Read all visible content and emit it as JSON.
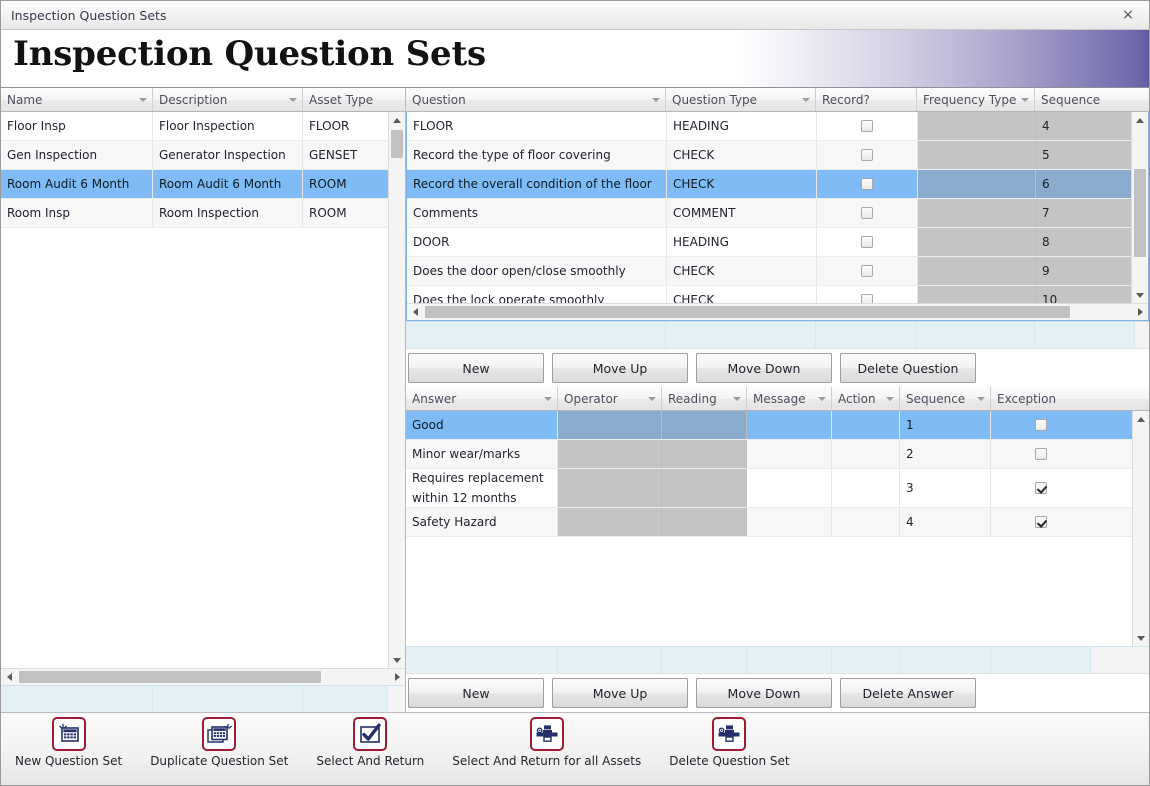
{
  "window": {
    "title": "Inspection Question Sets",
    "close_icon": "close-icon",
    "close_glyph": "×"
  },
  "header": {
    "title": "Inspection Question Sets"
  },
  "question_sets_grid": {
    "columns": [
      {
        "label": "Name",
        "sortable": true
      },
      {
        "label": "Description",
        "sortable": true
      },
      {
        "label": "Asset Type",
        "sortable": false
      }
    ],
    "rows": [
      {
        "name": "Floor Insp",
        "description": "Floor Inspection",
        "asset_type": "FLOOR",
        "selected": false
      },
      {
        "name": "Gen Inspection",
        "description": "Generator Inspection",
        "asset_type": "GENSET",
        "selected": false
      },
      {
        "name": "Room Audit 6 Month",
        "description": "Room Audit 6 Month",
        "asset_type": "ROOM",
        "selected": true
      },
      {
        "name": "Room Insp",
        "description": "Room Inspection",
        "asset_type": "ROOM",
        "selected": false
      }
    ]
  },
  "questions_grid": {
    "columns": [
      {
        "label": "Question",
        "sortable": true
      },
      {
        "label": "Question Type",
        "sortable": true
      },
      {
        "label": "Record?",
        "sortable": false
      },
      {
        "label": "Frequency Type",
        "sortable": true
      },
      {
        "label": "Sequence",
        "sortable": false
      }
    ],
    "rows": [
      {
        "question": "FLOOR",
        "type": "HEADING",
        "record": false,
        "frequency_type": "",
        "sequence": "4",
        "selected": false
      },
      {
        "question": "Record the type of floor covering",
        "type": "CHECK",
        "record": false,
        "frequency_type": "",
        "sequence": "5",
        "selected": false
      },
      {
        "question": "Record the overall condition of the floor",
        "type": "CHECK",
        "record": false,
        "frequency_type": "",
        "sequence": "6",
        "selected": true
      },
      {
        "question": "Comments",
        "type": "COMMENT",
        "record": false,
        "frequency_type": "",
        "sequence": "7",
        "selected": false
      },
      {
        "question": "DOOR",
        "type": "HEADING",
        "record": false,
        "frequency_type": "",
        "sequence": "8",
        "selected": false
      },
      {
        "question": "Does the door open/close smoothly",
        "type": "CHECK",
        "record": false,
        "frequency_type": "",
        "sequence": "9",
        "selected": false
      },
      {
        "question": "Does the lock operate smoothly",
        "type": "CHECK",
        "record": false,
        "frequency_type": "",
        "sequence": "10",
        "selected": false
      }
    ]
  },
  "question_buttons": {
    "new": "New",
    "move_up": "Move Up",
    "move_down": "Move Down",
    "delete": "Delete Question"
  },
  "answers_grid": {
    "columns": [
      {
        "label": "Answer",
        "sortable": true
      },
      {
        "label": "Operator",
        "sortable": true
      },
      {
        "label": "Reading",
        "sortable": true
      },
      {
        "label": "Message",
        "sortable": true
      },
      {
        "label": "Action",
        "sortable": true
      },
      {
        "label": "Sequence",
        "sortable": true
      },
      {
        "label": "Exception",
        "sortable": false
      }
    ],
    "rows": [
      {
        "answer": "Good",
        "operator": "",
        "reading": "",
        "message": "",
        "action": "",
        "sequence": "1",
        "exception": false,
        "selected": true
      },
      {
        "answer": "Minor wear/marks",
        "operator": "",
        "reading": "",
        "message": "",
        "action": "",
        "sequence": "2",
        "exception": false,
        "selected": false
      },
      {
        "answer": "Requires replacement within 12 months",
        "operator": "",
        "reading": "",
        "message": "",
        "action": "",
        "sequence": "3",
        "exception": true,
        "selected": false
      },
      {
        "answer": "Safety Hazard",
        "operator": "",
        "reading": "",
        "message": "",
        "action": "",
        "sequence": "4",
        "exception": true,
        "selected": false
      }
    ]
  },
  "answer_buttons": {
    "new": "New",
    "move_up": "Move Up",
    "move_down": "Move Down",
    "delete": "Delete Answer"
  },
  "toolbar": {
    "items": [
      {
        "label": "New Question Set",
        "icon": "new-question-set-icon"
      },
      {
        "label": "Duplicate Question Set",
        "icon": "duplicate-question-set-icon"
      },
      {
        "label": "Select And Return",
        "icon": "select-and-return-icon"
      },
      {
        "label": "Select And Return for all Assets",
        "icon": "select-and-return-all-assets-icon"
      },
      {
        "label": "Delete Question Set",
        "icon": "delete-question-set-icon"
      }
    ]
  },
  "colors": {
    "selection": "#7fbcf5",
    "selection_disabled": "#8aabcd",
    "disabled_cell": "#c4c4c4",
    "header_accent": "#635ba2",
    "icon_border": "#9e1b32",
    "icon_fill": "#23306b",
    "grid_focus_border": "#7fb0e8",
    "footer_strip": "#e3f0f6"
  }
}
